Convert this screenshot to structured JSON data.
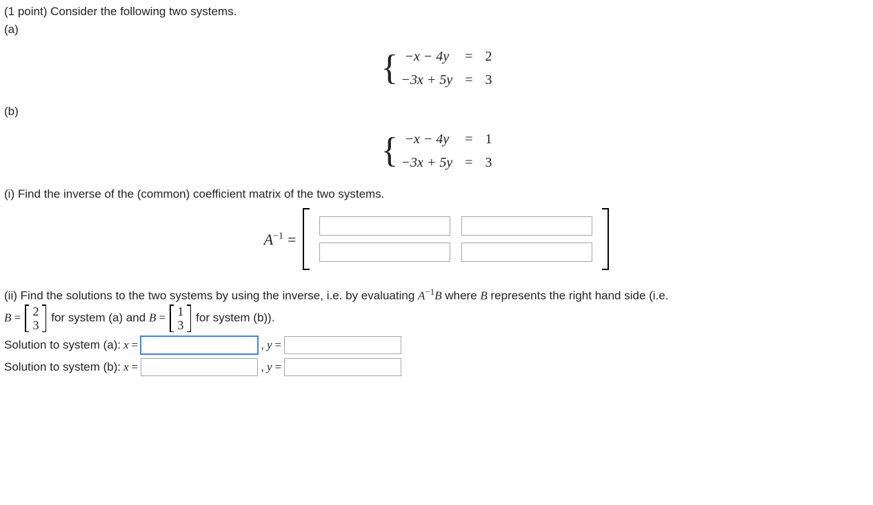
{
  "points_line": "(1 point) Consider the following two systems.",
  "parts": {
    "a": "(a)",
    "b": "(b)"
  },
  "system_a": {
    "row1": {
      "lhs": "−x − 4y",
      "eq": "=",
      "rhs": "2"
    },
    "row2": {
      "lhs": "−3x + 5y",
      "eq": "=",
      "rhs": "3"
    }
  },
  "system_b": {
    "row1": {
      "lhs": "−x − 4y",
      "eq": "=",
      "rhs": "1"
    },
    "row2": {
      "lhs": "−3x + 5y",
      "eq": "=",
      "rhs": "3"
    }
  },
  "part_i_text": "(i) Find the inverse of the (common) coefficient matrix of the two systems.",
  "Ainv_label_html": "A",
  "part_ii": {
    "lead": "(ii) Find the solutions to the two systems by using the inverse, i.e. by evaluating ",
    "mid1": " where ",
    "mid2": " represents the right hand side (i.e. ",
    "B_a": [
      "2",
      "3"
    ],
    "txt_a": " for system (a) and ",
    "B_b": [
      "1",
      "3"
    ],
    "txt_b": " for system (b))."
  },
  "sol_a_label": "Solution to system (a): ",
  "sol_b_label": "Solution to system (b): ",
  "x_eq": "x =",
  "comma": ", ",
  "y_eq": "y ="
}
